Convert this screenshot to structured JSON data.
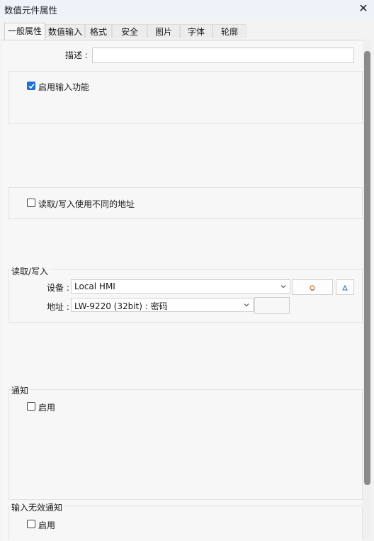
{
  "window": {
    "title": "数值元件属性",
    "close_icon": "close-icon"
  },
  "tabs": [
    {
      "label": "一般属性",
      "active": true
    },
    {
      "label": "数值输入"
    },
    {
      "label": "格式"
    },
    {
      "label": "安全"
    },
    {
      "label": "图片"
    },
    {
      "label": "字体"
    },
    {
      "label": "轮廓"
    }
  ],
  "general": {
    "description_label": "描述 :",
    "description_value": "",
    "enable_input_label": "启用输入功能",
    "enable_input_checked": true,
    "rw_diff_addr_label": "读取/写入使用不同的地址",
    "rw_diff_addr_checked": false
  },
  "rw": {
    "section_title": "读取/写入",
    "device_label": "设备 :",
    "device_value": "Local HMI",
    "address_label": "地址 :",
    "address_value": "LW-9220 (32bit) : 密码",
    "address_suffix_value": ""
  },
  "notify": {
    "section_title": "通知",
    "enable_label": "启用",
    "enable_checked": false
  },
  "invalid_notify": {
    "section_title": "输入无效通知",
    "enable_label": "启用",
    "enable_checked": false
  },
  "colors": {
    "accent": "#1f6fd6",
    "titlebar": "#eef3f9",
    "panel": "#f7f7f7"
  }
}
